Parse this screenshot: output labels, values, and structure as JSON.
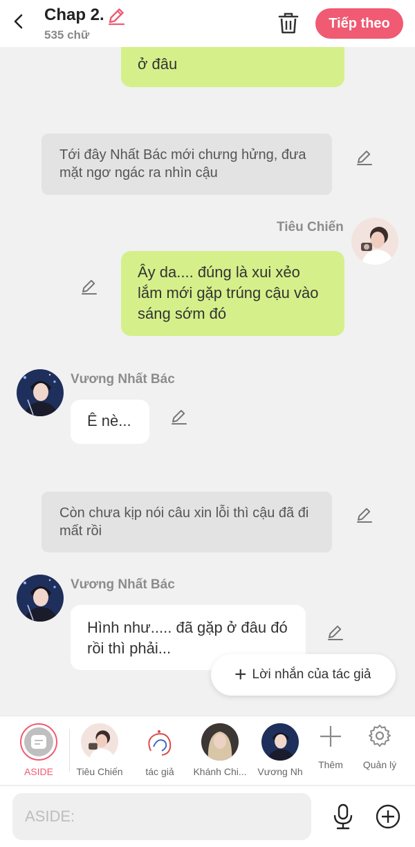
{
  "header": {
    "title": "Chap 2.",
    "word_count": "535 chữ",
    "next_label": "Tiếp theo"
  },
  "messages": {
    "m1_tail": "ở đâu",
    "narr1": "Tới đây Nhất Bác mới chưng hửng, đưa mặt ngơ ngác ra nhìn cậu",
    "speaker1": "Tiêu Chiến",
    "m2": "Ây da.... đúng là xui xẻo lắm mới gặp trúng cậu vào sáng sớm đó",
    "speaker2": "Vương Nhất Bác",
    "m3": "Ê nè...",
    "narr2": "Còn chưa kịp nói câu xin lỗi thì cậu đã đi mất rồi",
    "speaker3": "Vương Nhất Bác",
    "m4": "Hình như..... đã gặp ở đâu đó rồi thì phải..."
  },
  "author_note": "Lời nhắn của tác giả",
  "characters": [
    {
      "label": "ASIDE"
    },
    {
      "label": "Tiêu Chiến"
    },
    {
      "label": "tác giả"
    },
    {
      "label": "Khánh Chi..."
    },
    {
      "label": "Vương Nh"
    },
    {
      "label": "Thêm"
    },
    {
      "label": "Quản lý"
    }
  ],
  "input": {
    "placeholder": "ASIDE:"
  },
  "colors": {
    "accent": "#f05a72",
    "green_bubble": "#d5f08a",
    "narration": "#e3e3e3"
  }
}
